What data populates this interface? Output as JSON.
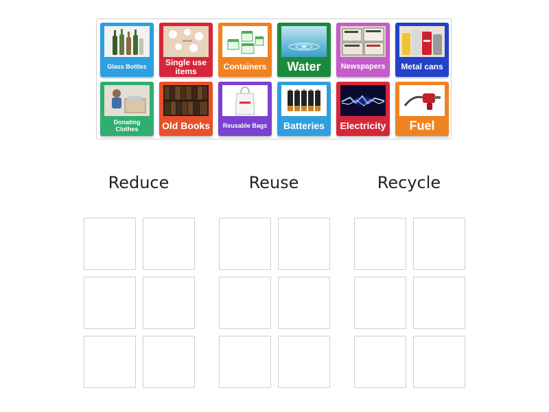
{
  "bank": {
    "cards": [
      {
        "label": "Glass Bottles",
        "color": "#2f9fe0",
        "icon": "glass-bottles-photo"
      },
      {
        "label": "Single use items",
        "color": "#d6263a",
        "icon": "single-use-items-photo"
      },
      {
        "label": "Containers",
        "color": "#f08321",
        "icon": "containers-photo"
      },
      {
        "label": "Water",
        "color": "#1a8a3d",
        "icon": "water-drop-photo"
      },
      {
        "label": "Newspapers",
        "color": "#c45cc9",
        "icon": "newspapers-photo"
      },
      {
        "label": "Metal cans",
        "color": "#2442c7",
        "icon": "metal-cans-photo"
      },
      {
        "label": "Donating Clothes",
        "color": "#2fae70",
        "icon": "donating-clothes-photo"
      },
      {
        "label": "Old Books",
        "color": "#e8502a",
        "icon": "old-books-photo"
      },
      {
        "label": "Reusable Bags",
        "color": "#7b42cf",
        "icon": "reusable-bag-photo"
      },
      {
        "label": "Batteries",
        "color": "#2f9fe0",
        "icon": "batteries-photo"
      },
      {
        "label": "Electricity",
        "color": "#d6263a",
        "icon": "electricity-photo"
      },
      {
        "label": "Fuel",
        "color": "#f08321",
        "icon": "fuel-nozzle-photo"
      }
    ]
  },
  "columns": [
    {
      "title": "Reduce"
    },
    {
      "title": "Reuse"
    },
    {
      "title": "Recycle"
    }
  ]
}
